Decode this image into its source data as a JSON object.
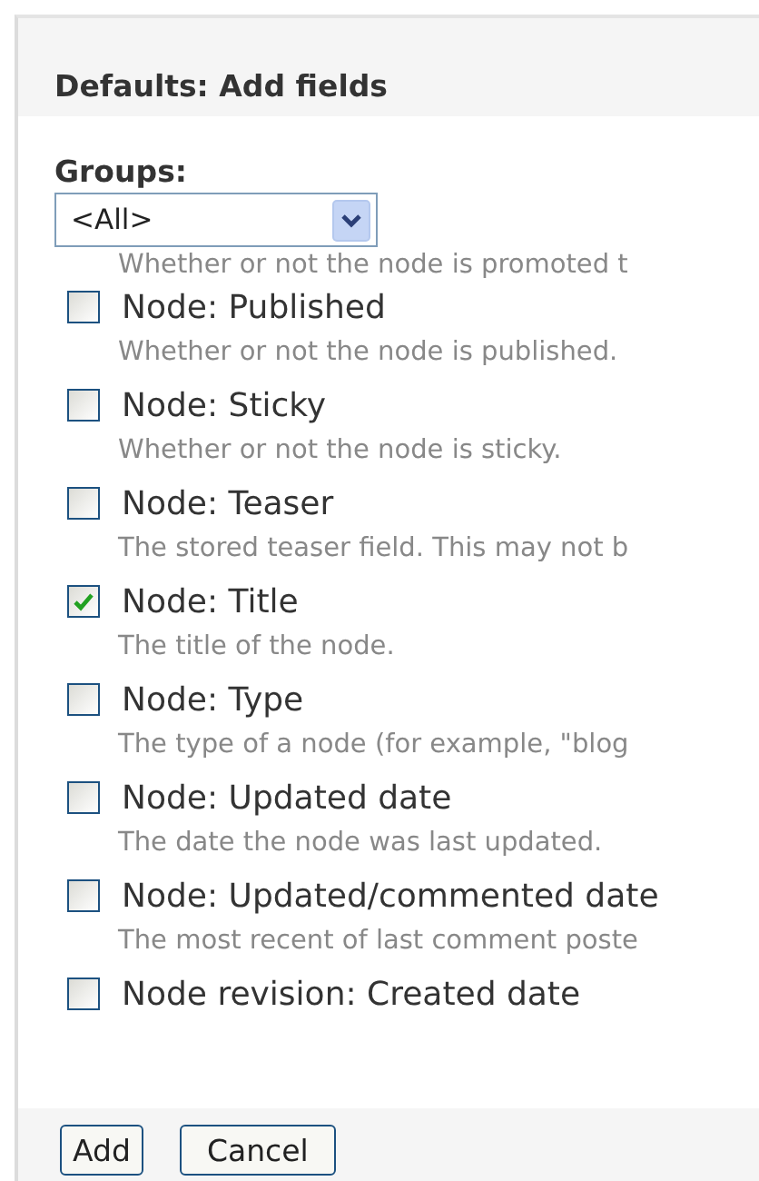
{
  "title": "Defaults: Add fields",
  "groups": {
    "label": "Groups:",
    "value": "<All>"
  },
  "partial_description": "Whether or not the node is promoted t",
  "fields": [
    {
      "label": "Node: Published",
      "description": "Whether or not the node is published.",
      "checked": false
    },
    {
      "label": "Node: Sticky",
      "description": "Whether or not the node is sticky.",
      "checked": false
    },
    {
      "label": "Node: Teaser",
      "description": "The stored teaser field. This may not b",
      "checked": false
    },
    {
      "label": "Node: Title",
      "description": "The title of the node.",
      "checked": true
    },
    {
      "label": "Node: Type",
      "description": "The type of a node (for example, \"blog",
      "checked": false
    },
    {
      "label": "Node: Updated date",
      "description": "The date the node was last updated.",
      "checked": false
    },
    {
      "label": "Node: Updated/commented date",
      "description": "The most recent of last comment poste",
      "checked": false
    },
    {
      "label": "Node revision: Created date",
      "checked": false
    }
  ],
  "buttons": [
    "Add",
    "Cancel"
  ]
}
